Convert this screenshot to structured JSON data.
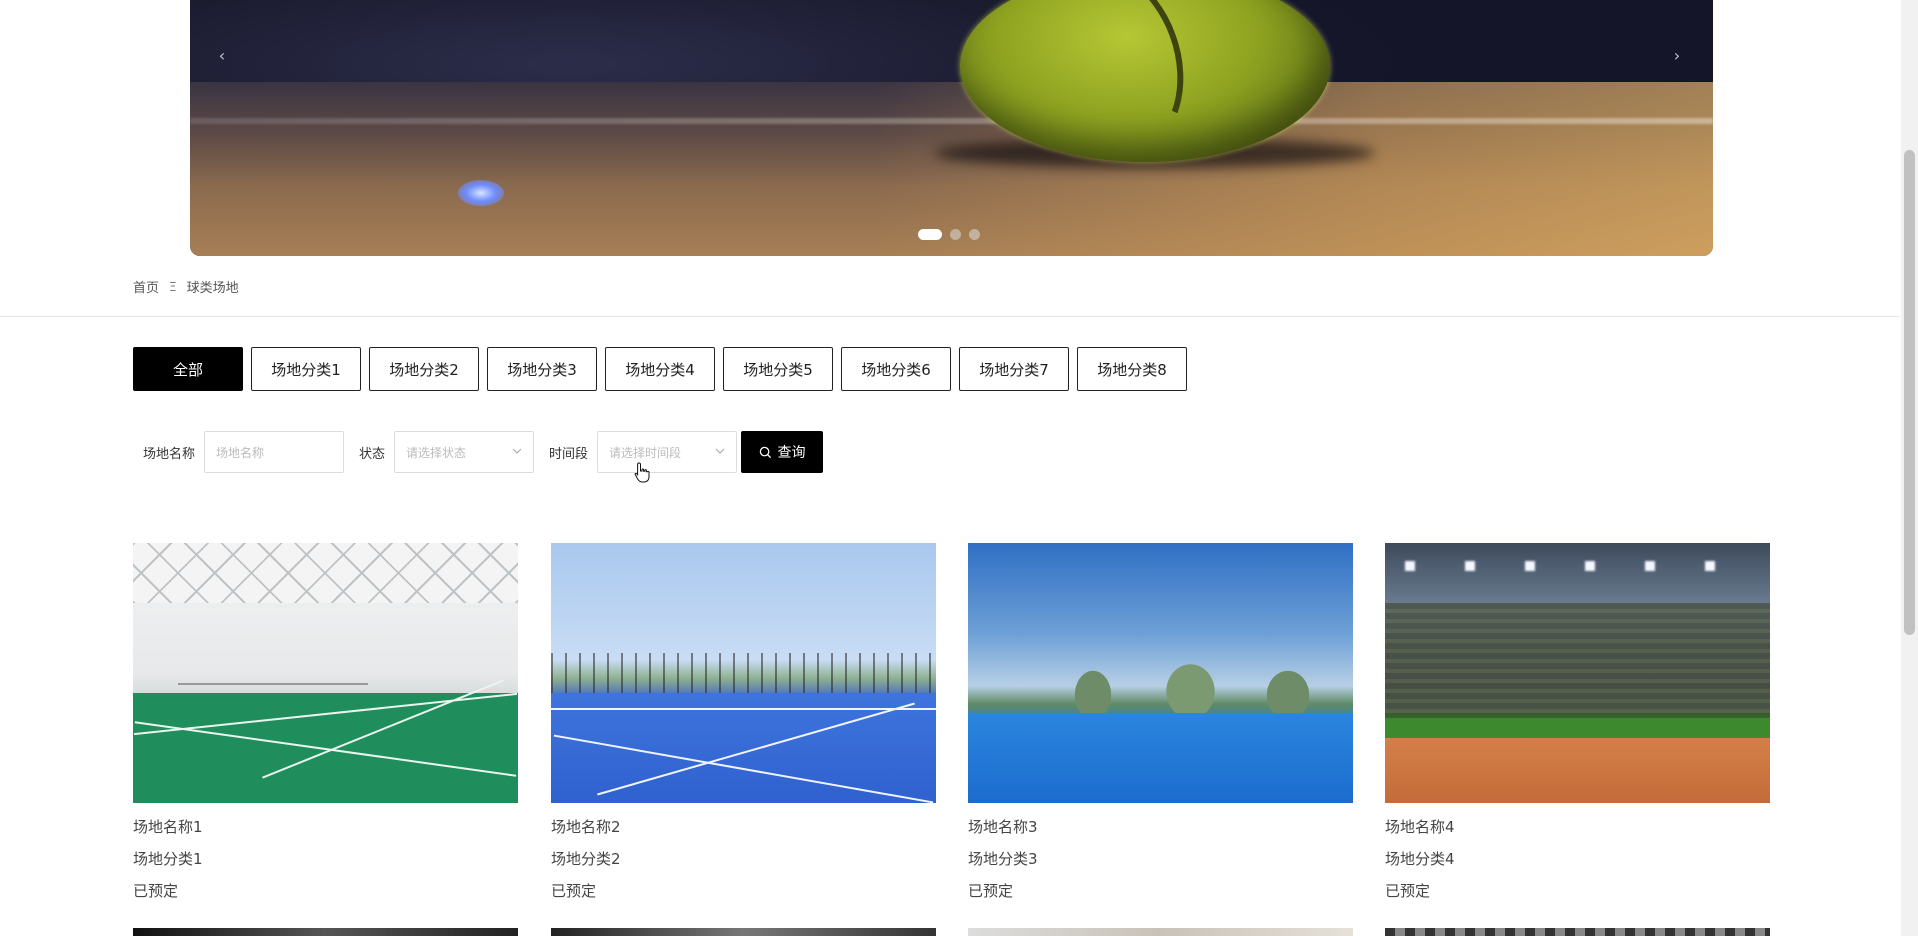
{
  "banner": {
    "prev_arrow": "‹",
    "next_arrow": "›",
    "slide_count": 3,
    "active_slide": 1
  },
  "breadcrumb": {
    "home": "首页",
    "separator": "Ξ",
    "current": "球类场地"
  },
  "tabs": [
    {
      "label": "全部",
      "active": true
    },
    {
      "label": "场地分类1",
      "active": false
    },
    {
      "label": "场地分类2",
      "active": false
    },
    {
      "label": "场地分类3",
      "active": false
    },
    {
      "label": "场地分类4",
      "active": false
    },
    {
      "label": "场地分类5",
      "active": false
    },
    {
      "label": "场地分类6",
      "active": false
    },
    {
      "label": "场地分类7",
      "active": false
    },
    {
      "label": "场地分类8",
      "active": false
    }
  ],
  "filters": {
    "name_label": "场地名称",
    "name_placeholder": "场地名称",
    "status_label": "状态",
    "status_placeholder": "请选择状态",
    "timeslot_label": "时间段",
    "timeslot_placeholder": "请选择时间段",
    "search_label": "查询"
  },
  "venues": [
    {
      "name": "场地名称1",
      "category": "场地分类1",
      "status": "已预定",
      "image": "badminton-court"
    },
    {
      "name": "场地名称2",
      "category": "场地分类2",
      "status": "已预定",
      "image": "tennis-court"
    },
    {
      "name": "场地名称3",
      "category": "场地分类3",
      "status": "已预定",
      "image": "tennis-court"
    },
    {
      "name": "场地名称4",
      "category": "场地分类4",
      "status": "已预定",
      "image": "baseball-stadium"
    }
  ],
  "colors": {
    "accent": "#000000",
    "border": "#222222",
    "muted_text": "#bbbbbb"
  }
}
